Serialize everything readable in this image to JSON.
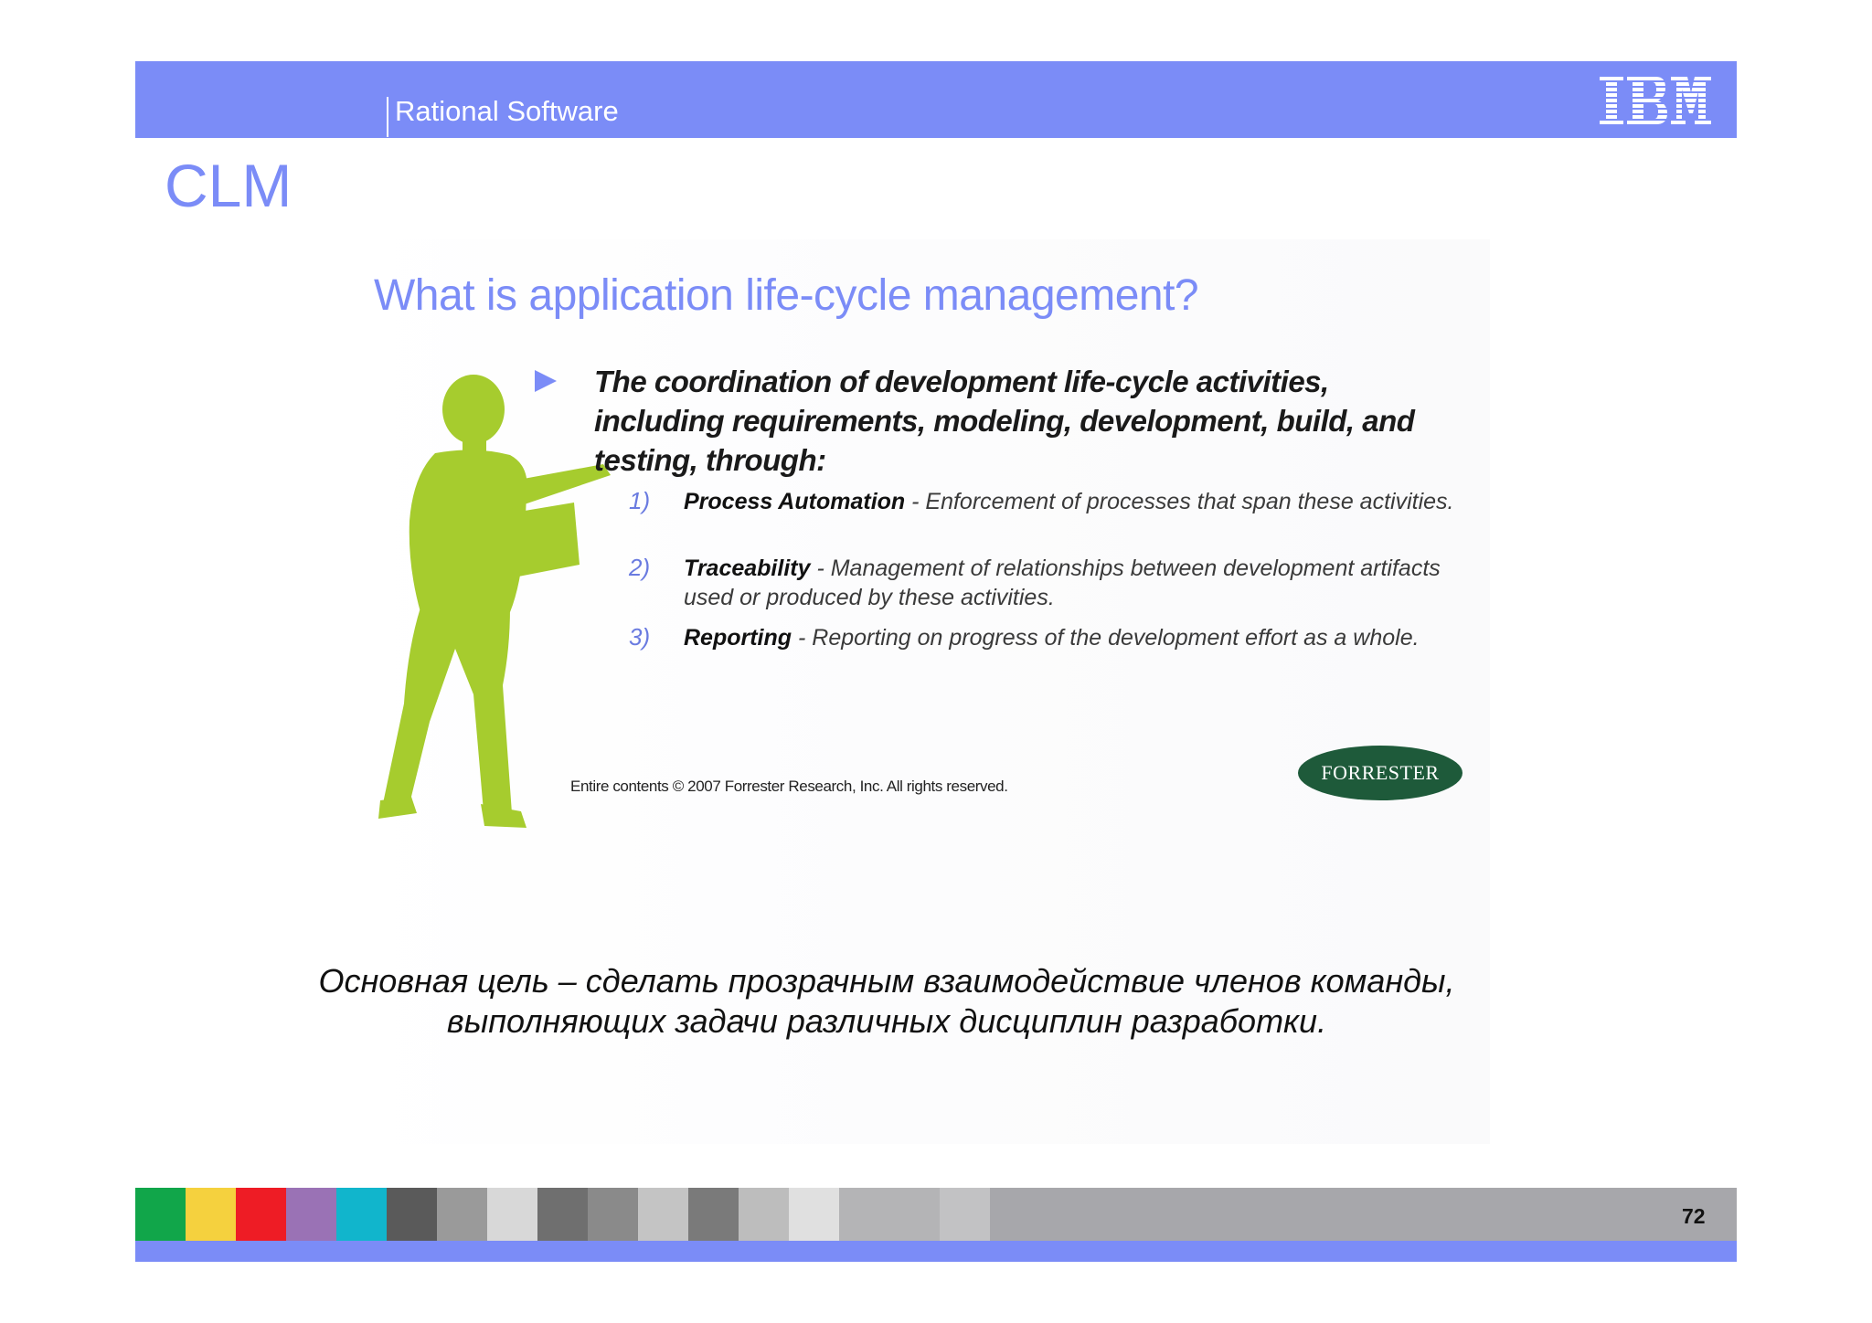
{
  "header": {
    "brand": "Rational Software",
    "logo_text": "IBM",
    "bar_color": "#7b8cf7"
  },
  "slide": {
    "title": "CLM",
    "embedded": {
      "heading": "What is application life-cycle management?",
      "lead": "The coordination of development life-cycle activities, including requirements, modeling, development, build, and testing, through:",
      "items": [
        {
          "num": "1)",
          "term": "Process Automation",
          "desc": " - Enforcement of processes that span these activities."
        },
        {
          "num": "2)",
          "term": "Traceability",
          "desc": " - Management of relationships between development artifacts used or produced by these activities."
        },
        {
          "num": "3)",
          "term": "Reporting",
          "desc": " - Reporting on progress of the development effort as a whole."
        }
      ],
      "copyright": "Entire contents © 2007 Forrester Research, Inc. All rights reserved.",
      "forrester_logo": "FORRESTER",
      "figure": "green-silhouette-person-icon",
      "figure_color": "#a6cc2e"
    },
    "caption": "Основная цель – сделать прозрачным взаимодействие членов команды, выполняющих задачи различных дисциплин разработки."
  },
  "footer": {
    "page_number": "72",
    "swatches": [
      "#11a64a",
      "#f5d13e",
      "#ee1c25",
      "#9a72b5",
      "#11b5cc"
    ]
  }
}
